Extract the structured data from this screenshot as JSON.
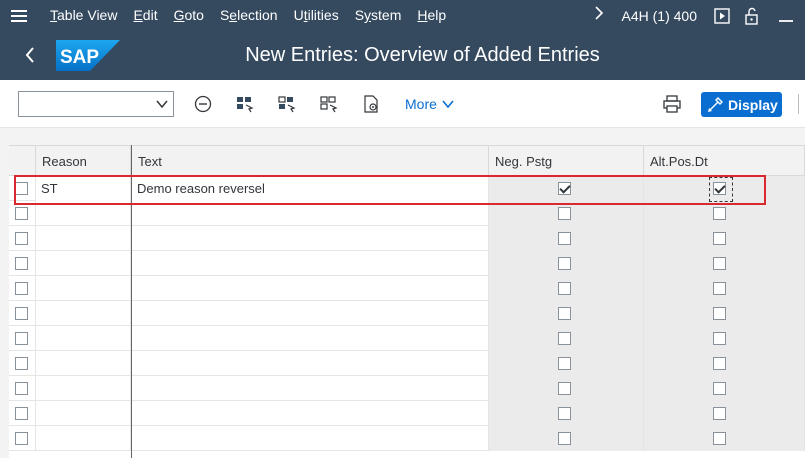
{
  "menubar": {
    "items": [
      {
        "label": "Table View",
        "ul": "T"
      },
      {
        "label": "Edit",
        "ul": "E"
      },
      {
        "label": "Goto",
        "ul": "G"
      },
      {
        "label": "Selection",
        "ul": "e"
      },
      {
        "label": "Utilities",
        "ul": "t"
      },
      {
        "label": "System",
        "ul": "y"
      },
      {
        "label": "Help",
        "ul": "H"
      }
    ],
    "system_info": "A4H (1) 400"
  },
  "titlebar": {
    "logo_text": "SAP",
    "title": "New Entries: Overview of Added Entries"
  },
  "toolbar": {
    "dropdown_value": "",
    "more_label": "More",
    "display_label": "Display"
  },
  "table": {
    "headers": [
      "Reason",
      "Text",
      "Neg. Pstg",
      "Alt.Pos.Dt"
    ],
    "rows": [
      {
        "reason": "ST",
        "text": "Demo reason reversel",
        "neg_pstg": true,
        "alt_pos_dt": true
      },
      {
        "reason": "",
        "text": "",
        "neg_pstg": false,
        "alt_pos_dt": false
      },
      {
        "reason": "",
        "text": "",
        "neg_pstg": false,
        "alt_pos_dt": false
      },
      {
        "reason": "",
        "text": "",
        "neg_pstg": false,
        "alt_pos_dt": false
      },
      {
        "reason": "",
        "text": "",
        "neg_pstg": false,
        "alt_pos_dt": false
      },
      {
        "reason": "",
        "text": "",
        "neg_pstg": false,
        "alt_pos_dt": false
      },
      {
        "reason": "",
        "text": "",
        "neg_pstg": false,
        "alt_pos_dt": false
      },
      {
        "reason": "",
        "text": "",
        "neg_pstg": false,
        "alt_pos_dt": false
      },
      {
        "reason": "",
        "text": "",
        "neg_pstg": false,
        "alt_pos_dt": false
      },
      {
        "reason": "",
        "text": "",
        "neg_pstg": false,
        "alt_pos_dt": false
      },
      {
        "reason": "",
        "text": "",
        "neg_pstg": false,
        "alt_pos_dt": false
      }
    ]
  },
  "colors": {
    "shell": "#354a5f",
    "accent": "#0a6ed1",
    "highlight": "#d9282f"
  }
}
